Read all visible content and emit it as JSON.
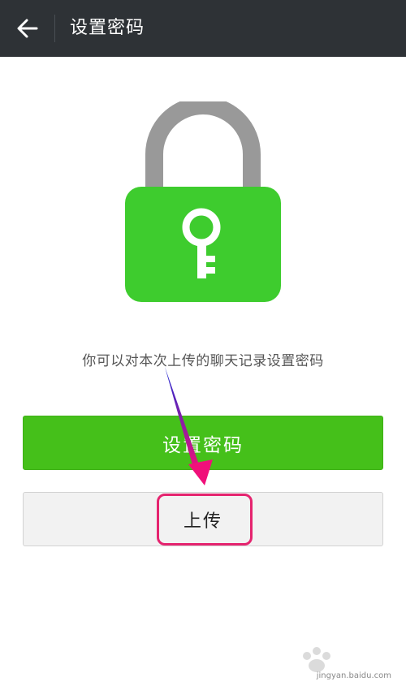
{
  "header": {
    "title": "设置密码",
    "back_icon": "arrow-left-icon"
  },
  "hero": {
    "icon": "padlock-key-icon",
    "lock_body_color": "#3ecc2e",
    "shackle_color": "#999999"
  },
  "description": "你可以对本次上传的聊天记录设置密码",
  "buttons": {
    "set_password": "设置密码",
    "upload": "上传"
  },
  "colors": {
    "topbar": "#2e3236",
    "primary_button": "#45c01a",
    "highlight": "#e5246f"
  },
  "watermark": {
    "text": "jingyan.baidu.com"
  }
}
